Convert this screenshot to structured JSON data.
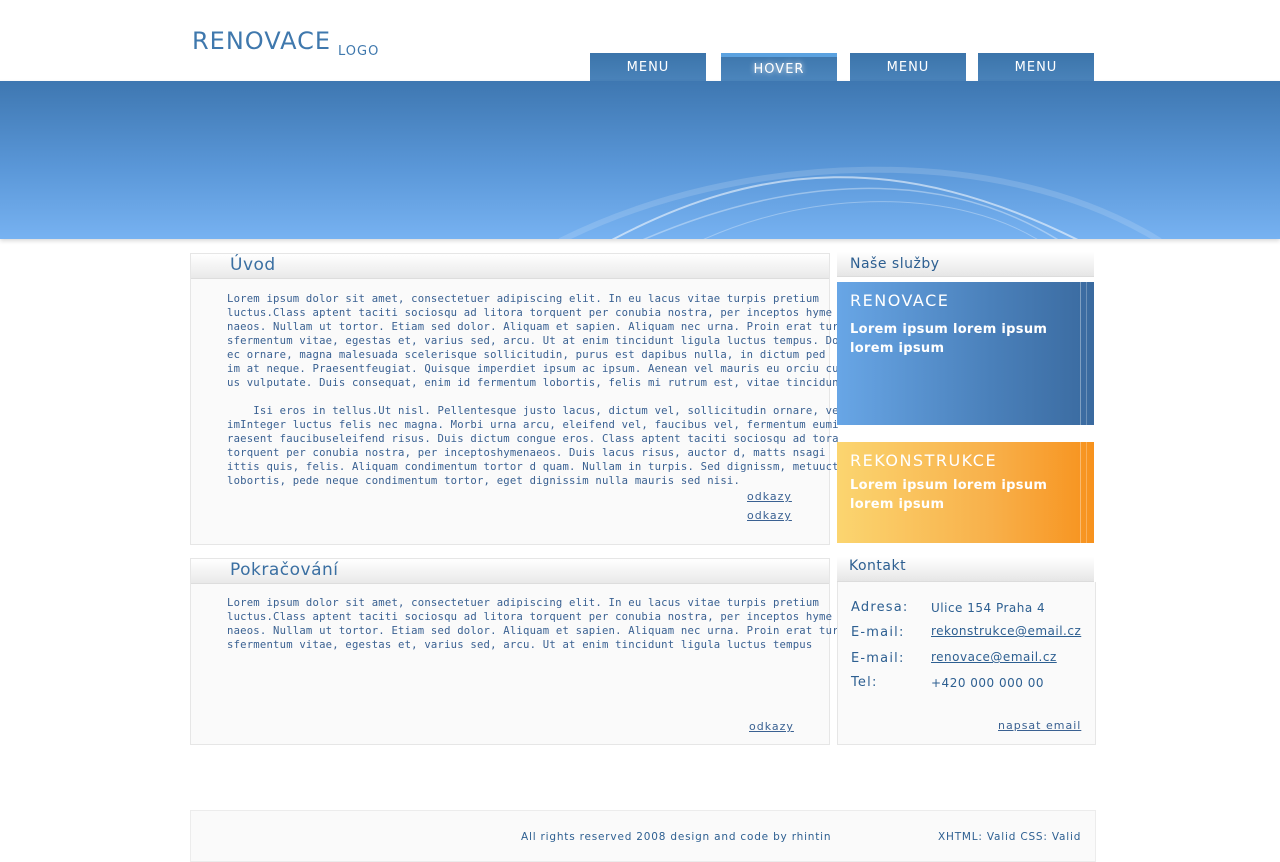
{
  "header": {
    "logo": "RENOVACE",
    "logo_sub": "LOGO",
    "nav": [
      "MENU",
      "HOVER",
      "MENU",
      "MENU"
    ]
  },
  "articles": [
    {
      "title": "Úvod",
      "paragraphs": [
        "Lorem ipsum dolor sit amet, consectetuer adipiscing elit. In eu lacus vitae turpis pretium\nluctus.Class aptent taciti sociosqu ad litora torquent per conubia nostra, per inceptos hyme\nnaeos. Nullam ut tortor. Etiam sed dolor. Aliquam et sapien. Aliquam nec urna. Proin erat turp\nsfermentum vitae, egestas et, varius sed, arcu. Ut at enim tincidunt ligula luctus tempus. Do\nec ornare, magna malesuada scelerisque sollicitudin, purus est dapibus nulla, in dictum ped  e\nim at neque. Praesentfeugiat. Quisque imperdiet ipsum ac ipsum. Aenean vel mauris eu orciu cu\nus vulputate. Duis consequat, enim id fermentum lobortis, felis mi rutrum est, vitae tincidunt",
        "    Isi eros in tellus.Ut nisl. Pellentesque justo lacus, dictum vel, sollicitudin ornare, vehcula\nimInteger luctus felis nec magna. Morbi urna arcu, eleifend vel, faucibus vel, fermentum eumi\nraesent faucibuseleifend risus. Duis dictum congue eros. Class aptent taciti sociosqu ad tora\ntorquent per conubia nostra, per inceptoshymenaeos. Duis lacus risus, auctor d, matts nsagi\nittis quis, felis. Aliquam condimentum tortor d quam. Nullam in turpis. Sed dignissm, metuuctn\nlobortis, pede neque condimentum tortor, eget dignissim nulla mauris sed nisi."
      ],
      "links": [
        "odkazy",
        "odkazy"
      ]
    },
    {
      "title": "Pokračování",
      "paragraphs": [
        "Lorem ipsum dolor sit amet, consectetuer adipiscing elit. In eu lacus vitae turpis pretium\nluctus.Class aptent taciti sociosqu ad litora torquent per conubia nostra, per inceptos hyme\nnaeos. Nullam ut tortor. Etiam sed dolor. Aliquam et sapien. Aliquam nec urna. Proin erat turp\nsfermentum vitae, egestas et, varius sed, arcu. Ut at enim tincidunt ligula luctus tempus"
      ],
      "links": [
        "odkazy"
      ]
    }
  ],
  "sidebar": {
    "services_title": "Naše služby",
    "promos": [
      {
        "title": "RENOVACE",
        "text": "Lorem ipsum lorem ipsum lorem ipsum",
        "color": "#4a80ba"
      },
      {
        "title": "REKONSTRUKCE",
        "text": "Lorem ipsum lorem ipsum lorem ipsum",
        "color": "#f8a83a"
      }
    ],
    "contact_title": "Kontakt",
    "contact": [
      {
        "label": "Adresa:",
        "value": "Ulice 154 Praha 4"
      },
      {
        "label": "E-mail:",
        "value": "rekonstrukce@email.cz"
      },
      {
        "label": "E-mail:",
        "value": "renovace@email.cz"
      },
      {
        "label": "Tel:",
        "value": "+420 000 000 00"
      }
    ],
    "contact_link": "napsat email"
  },
  "footer": {
    "copyright": "All rights reserved 2008 design and code by rhintin",
    "validators": "XHTML: Valid CSS: Valid"
  },
  "colors": {
    "accent_blue": "#3b74aa",
    "banner_light": "#77b2f1",
    "orange": "#f7921d"
  }
}
